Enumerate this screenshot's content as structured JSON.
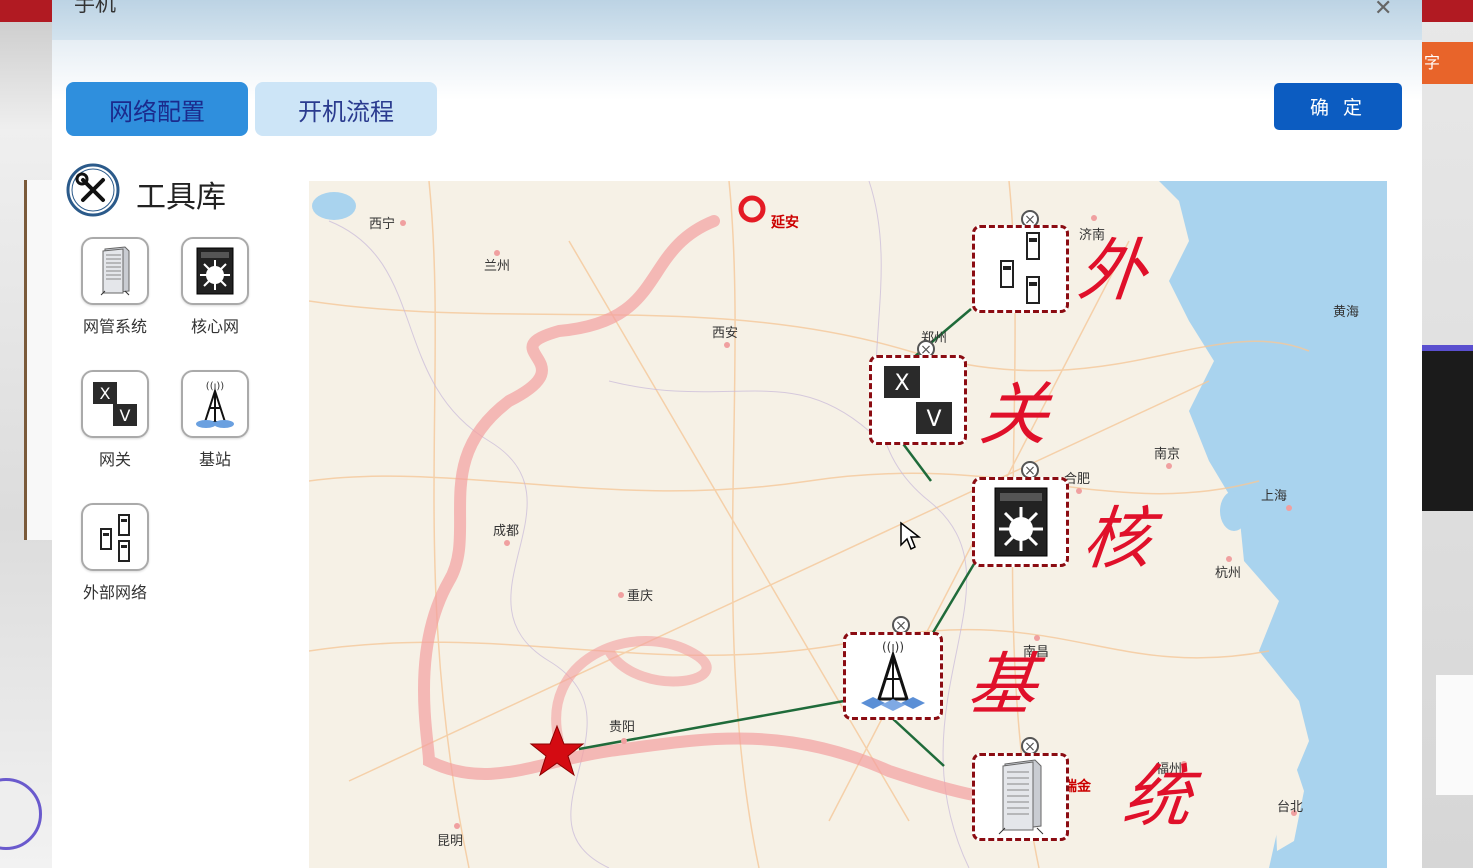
{
  "dialog": {
    "title": "手机",
    "close_icon": "close-icon"
  },
  "tabs": [
    {
      "label": "网络配置",
      "active": true
    },
    {
      "label": "开机流程",
      "active": false
    }
  ],
  "confirm_label": "确 定",
  "toolbox": {
    "title": "工具库",
    "items": [
      {
        "label": "网管系统",
        "icon": "server-icon"
      },
      {
        "label": "核心网",
        "icon": "core-network-icon"
      },
      {
        "label": "网关",
        "icon": "gateway-icon"
      },
      {
        "label": "基站",
        "icon": "base-station-icon"
      },
      {
        "label": "外部网络",
        "icon": "external-network-icon"
      }
    ]
  },
  "map": {
    "cities": [
      "西宁",
      "兰州",
      "延安",
      "西安",
      "郑州",
      "济南",
      "黄海",
      "合肥",
      "南京",
      "上海",
      "杭州",
      "成都",
      "重庆",
      "贵阳",
      "南昌",
      "福州",
      "瑞金",
      "台北",
      "昆明"
    ],
    "highlight_cities": [
      "延安",
      "瑞金"
    ],
    "annotations": [
      "外",
      "关",
      "核",
      "基",
      "统"
    ]
  },
  "colors": {
    "accent": "#2f8fdd",
    "confirm": "#0c5cc1",
    "node_border": "#8b0c12",
    "link": "#1f6b3a",
    "annotation": "#e0102a",
    "route": "#f4a0a0"
  }
}
